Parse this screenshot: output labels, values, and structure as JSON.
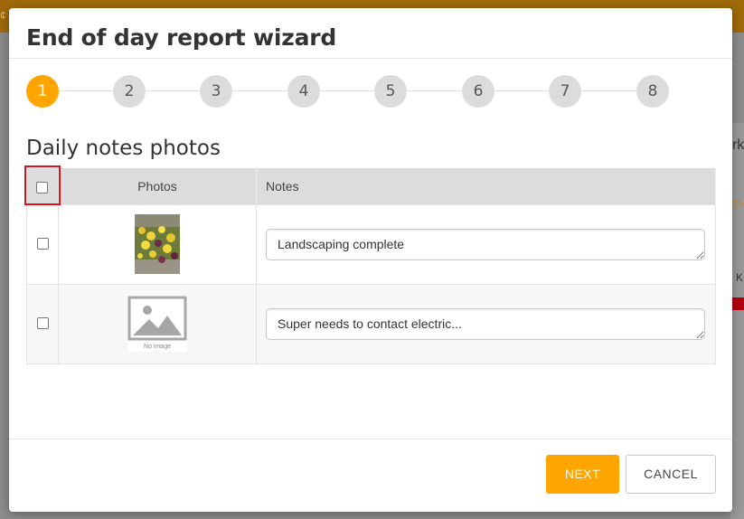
{
  "modal": {
    "title": "End of day report wizard",
    "section_title": "Daily notes photos"
  },
  "stepper": {
    "steps": [
      "1",
      "2",
      "3",
      "4",
      "5",
      "6",
      "7",
      "8"
    ],
    "active_step": "1"
  },
  "table": {
    "headers": {
      "photos": "Photos",
      "notes": "Notes"
    },
    "rows": [
      {
        "photo": "flowers-photo",
        "note": "Landscaping complete",
        "checked": false
      },
      {
        "photo": "no-image",
        "note": "Super needs to contact electric...",
        "checked": false
      }
    ],
    "no_image_label": "No image"
  },
  "buttons": {
    "next": "NEXT",
    "cancel": "CANCEL"
  },
  "colors": {
    "accent": "#ffa500",
    "step_inactive": "#dcdcdc",
    "highlight": "#e0101a"
  }
}
